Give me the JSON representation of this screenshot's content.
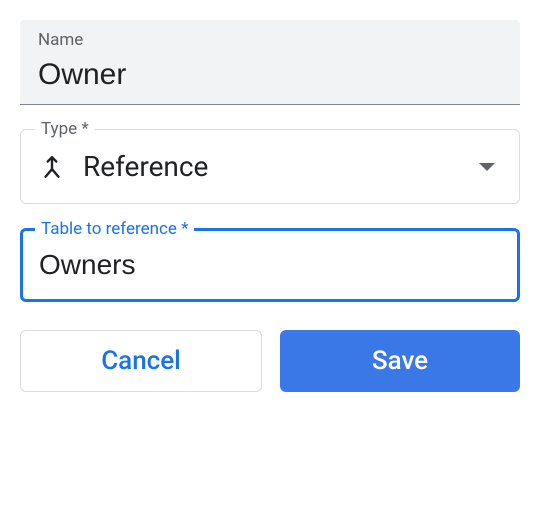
{
  "name_field": {
    "label": "Name",
    "value": "Owner"
  },
  "type_field": {
    "label": "Type *",
    "value": "Reference",
    "icon": "merge-icon"
  },
  "reference_field": {
    "label": "Table to reference *",
    "value": "Owners"
  },
  "buttons": {
    "cancel": "Cancel",
    "save": "Save"
  }
}
